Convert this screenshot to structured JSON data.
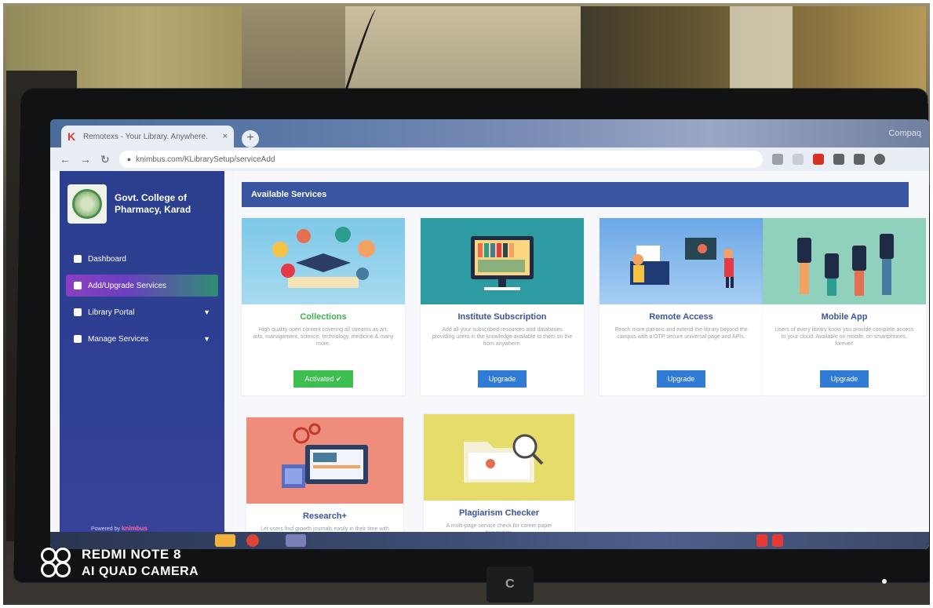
{
  "browser": {
    "tab_title": "Remotexs - Your Library. Anywhere.",
    "tab_close": "×",
    "new_tab": "+",
    "address": "knimbus.com/KLibrarySetup/serviceAdd",
    "brand_corner": "Compaq"
  },
  "sidebar": {
    "college_name_line1": "Govt. College of",
    "college_name_line2": "Pharmacy, Karad",
    "items": [
      {
        "label": "Dashboard",
        "active": false,
        "caret": ""
      },
      {
        "label": "Add/Upgrade Services",
        "active": true,
        "caret": ""
      },
      {
        "label": "Library Portal",
        "active": false,
        "caret": "▼"
      },
      {
        "label": "Manage Services",
        "active": false,
        "caret": "▼"
      }
    ],
    "powered_by": "Powered by",
    "powered_brand": "knimbus"
  },
  "main": {
    "header": "Available Services",
    "cards": [
      {
        "title": "Collections",
        "title_color": "#3cb34f",
        "desc": "High quality open content covering all streams as art, arts, management, science, technology, medicine & many more.",
        "button": "Activated ✔"
      },
      {
        "title": "Institute Subscription",
        "title_color": "#3a55a1",
        "desc": "Add all your subscribed resources and databases providing users in the knowledge available to them on the from anywhere.",
        "button": "Upgrade"
      },
      {
        "title": "Remote Access",
        "title_color": "#3a55a1",
        "desc": "Reach more patrons and extend the library beyond the campus with a OTP secure universal page and APIs.",
        "button": "Upgrade"
      },
      {
        "title": "Mobile App",
        "title_color": "#3a55a1",
        "desc": "Users of every library know you provide complete access to your cloud. Available on mobile, on smartphones, forever!",
        "button": "Upgrade"
      },
      {
        "title": "Research+",
        "title_color": "#3a55a1",
        "desc": "Let users find growth journals easily in their time with the right tool and the right feed.",
        "button": ""
      },
      {
        "title": "Plagiarism Checker",
        "title_color": "#3a55a1",
        "desc": "A multi-page service check for career paper documents.",
        "button": ""
      }
    ]
  },
  "watermark": {
    "line1": "REDMI NOTE 8",
    "line2": "AI QUAD CAMERA"
  },
  "colors": {
    "sidebar": "#2f3f95",
    "header": "#3a55a1",
    "activated": "#3cbf4f",
    "upgrade": "#2f7bd6"
  }
}
